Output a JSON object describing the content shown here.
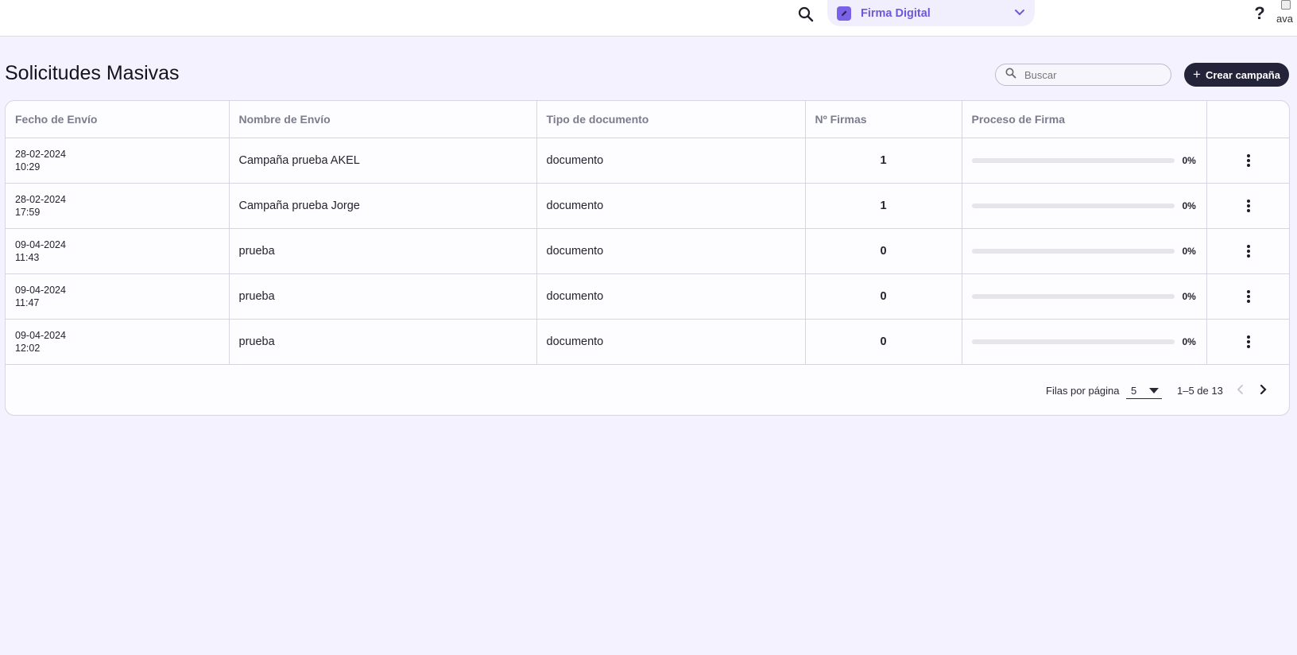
{
  "topbar": {
    "search_icon": "search-icon",
    "app_selector": {
      "label": "Firma Digital",
      "icon": "pen-icon",
      "chevron": "chevron-down-icon"
    },
    "help_label": "?",
    "avatar_alt": "ava"
  },
  "page": {
    "title": "Solicitudes Masivas",
    "search": {
      "placeholder": "Buscar",
      "value": ""
    },
    "create_button": "Crear campaña"
  },
  "table": {
    "columns": [
      "Fecho de Envío",
      "Nombre de Envío",
      "Tipo de documento",
      "Nº Firmas",
      "Proceso de Firma",
      ""
    ],
    "rows": [
      {
        "date": "28-02-2024",
        "time": "10:29",
        "name": "Campaña prueba AKEL",
        "doc_type": "documento",
        "signatures": "1",
        "progress": 0,
        "progress_label": "0%"
      },
      {
        "date": "28-02-2024",
        "time": "17:59",
        "name": "Campaña prueba Jorge",
        "doc_type": "documento",
        "signatures": "1",
        "progress": 0,
        "progress_label": "0%"
      },
      {
        "date": "09-04-2024",
        "time": "11:43",
        "name": "prueba",
        "doc_type": "documento",
        "signatures": "0",
        "progress": 0,
        "progress_label": "0%"
      },
      {
        "date": "09-04-2024",
        "time": "11:47",
        "name": "prueba",
        "doc_type": "documento",
        "signatures": "0",
        "progress": 0,
        "progress_label": "0%"
      },
      {
        "date": "09-04-2024",
        "time": "12:02",
        "name": "prueba",
        "doc_type": "documento",
        "signatures": "0",
        "progress": 0,
        "progress_label": "0%"
      }
    ]
  },
  "pagination": {
    "rows_per_page_label": "Filas por página",
    "rows_per_page": "5",
    "range": "1–5 de 13"
  },
  "colors": {
    "accent": "#6e58d9",
    "background": "#f4f2fe",
    "button_dark": "#23243a"
  }
}
